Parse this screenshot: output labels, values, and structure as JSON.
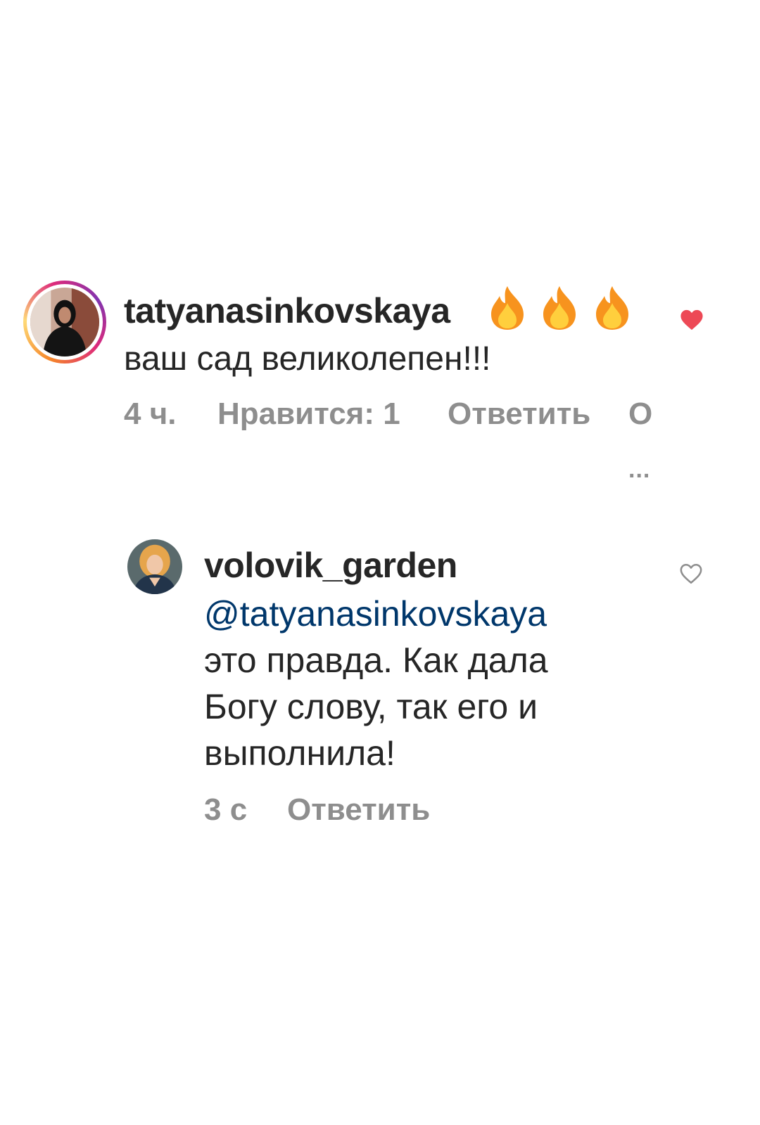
{
  "comment": {
    "username": "tatyanasinkovskaya",
    "emojis": "🔥🔥🔥",
    "text": "ваш сад великолепен!!!",
    "time": "4 ч.",
    "likes": "Нравится: 1",
    "reply": "Ответить",
    "more": "О",
    "more_dots": "...",
    "liked": true
  },
  "reply_comment": {
    "username": "volovik_garden",
    "mention": "@tatyanasinkovskaya",
    "lines": [
      "это правда. Как дала",
      "Богу слову, так его и",
      "выполнила!"
    ],
    "time": "3 с",
    "reply": "Ответить",
    "liked": false
  },
  "colors": {
    "text": "#262626",
    "meta": "#8e8e8e",
    "mention": "#00376b",
    "like_red": "#ed4956"
  },
  "icons": {
    "like_filled": "heart-filled-icon",
    "like_outline": "heart-outline-icon",
    "fire": "fire-emoji-icon"
  }
}
